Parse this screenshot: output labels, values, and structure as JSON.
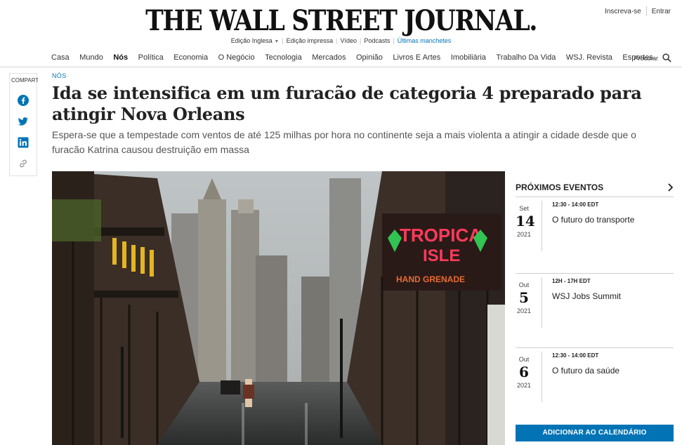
{
  "masthead": {
    "title": "THE WALL STREET JOURNAL."
  },
  "account": {
    "subscribe": "Inscreva-se",
    "signin": "Entrar"
  },
  "subnav": {
    "edition": "Edição Inglesa",
    "items": [
      "Edição impressa",
      "Vídeo",
      "Podcasts",
      "Últimas manchetes"
    ]
  },
  "nav": {
    "items": [
      "Casa",
      "Mundo",
      "Nós",
      "Política",
      "Economia",
      "O Negócio",
      "Tecnologia",
      "Mercados",
      "Opinião",
      "Livros E Artes",
      "Imobiliária",
      "Trabalho Da Vida",
      "WSJ. Revista",
      "Esportes"
    ],
    "search_label": "Procurar"
  },
  "share": {
    "label": "COMPARTILHAR"
  },
  "article": {
    "section": "NÓS",
    "headline": "Ida se intensifica em um furacão de categoria 4 preparado para atingir Nova Orleans",
    "dek": "Espera-se que a tempestade com ventos de até 125 milhas por hora no continente seja a mais violenta a atingir a cidade desde que o furacão Katrina causou destruição em massa"
  },
  "events": {
    "heading": "PRÓXIMOS EVENTOS",
    "items": [
      {
        "month": "Set",
        "day": "14",
        "year": "2021",
        "time": "12:30 - 14:00 EDT",
        "title": "O futuro do transporte"
      },
      {
        "month": "Out",
        "day": "5",
        "year": "2021",
        "time": "12H - 17H EDT",
        "title": "WSJ Jobs Summit"
      },
      {
        "month": "Out",
        "day": "6",
        "year": "2021",
        "time": "12:30 - 14:00 EDT",
        "title": "O futuro da saúde"
      }
    ],
    "calendar_button": "ADICIONAR AO CALENDÁRIO"
  },
  "photo": {
    "neon_text_1": "TROPICA",
    "neon_text_2": "ISLE",
    "neon_text_3": "HAND GRENADE"
  },
  "colors": {
    "link_blue": "#0274b6",
    "border_gray": "#d5d5d5"
  }
}
